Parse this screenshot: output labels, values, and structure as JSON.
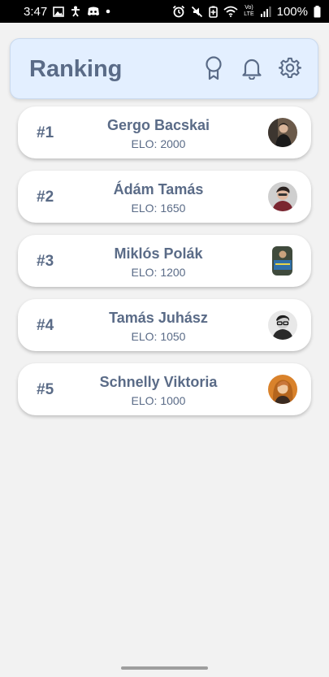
{
  "status_bar": {
    "time": "3:47",
    "battery": "100%",
    "network_top": "Vo)",
    "network_bottom": "LTE"
  },
  "header": {
    "title": "Ranking",
    "icons": [
      "badge-icon",
      "bell-icon",
      "gear-icon"
    ]
  },
  "players": [
    {
      "rank": "#1",
      "name": "Gergo Bacskai",
      "elo": "ELO: 2000"
    },
    {
      "rank": "#2",
      "name": "Ádám Tamás",
      "elo": "ELO: 1650"
    },
    {
      "rank": "#3",
      "name": "Miklós Polák",
      "elo": "ELO: 1200"
    },
    {
      "rank": "#4",
      "name": "Tamás Juhász",
      "elo": "ELO: 1050"
    },
    {
      "rank": "#5",
      "name": "Schnelly Viktoria",
      "elo": "ELO: 1000"
    }
  ],
  "colors": {
    "accent_text": "#5a6b87",
    "header_bg": "#e3efff",
    "page_bg": "#f2f2f2"
  }
}
